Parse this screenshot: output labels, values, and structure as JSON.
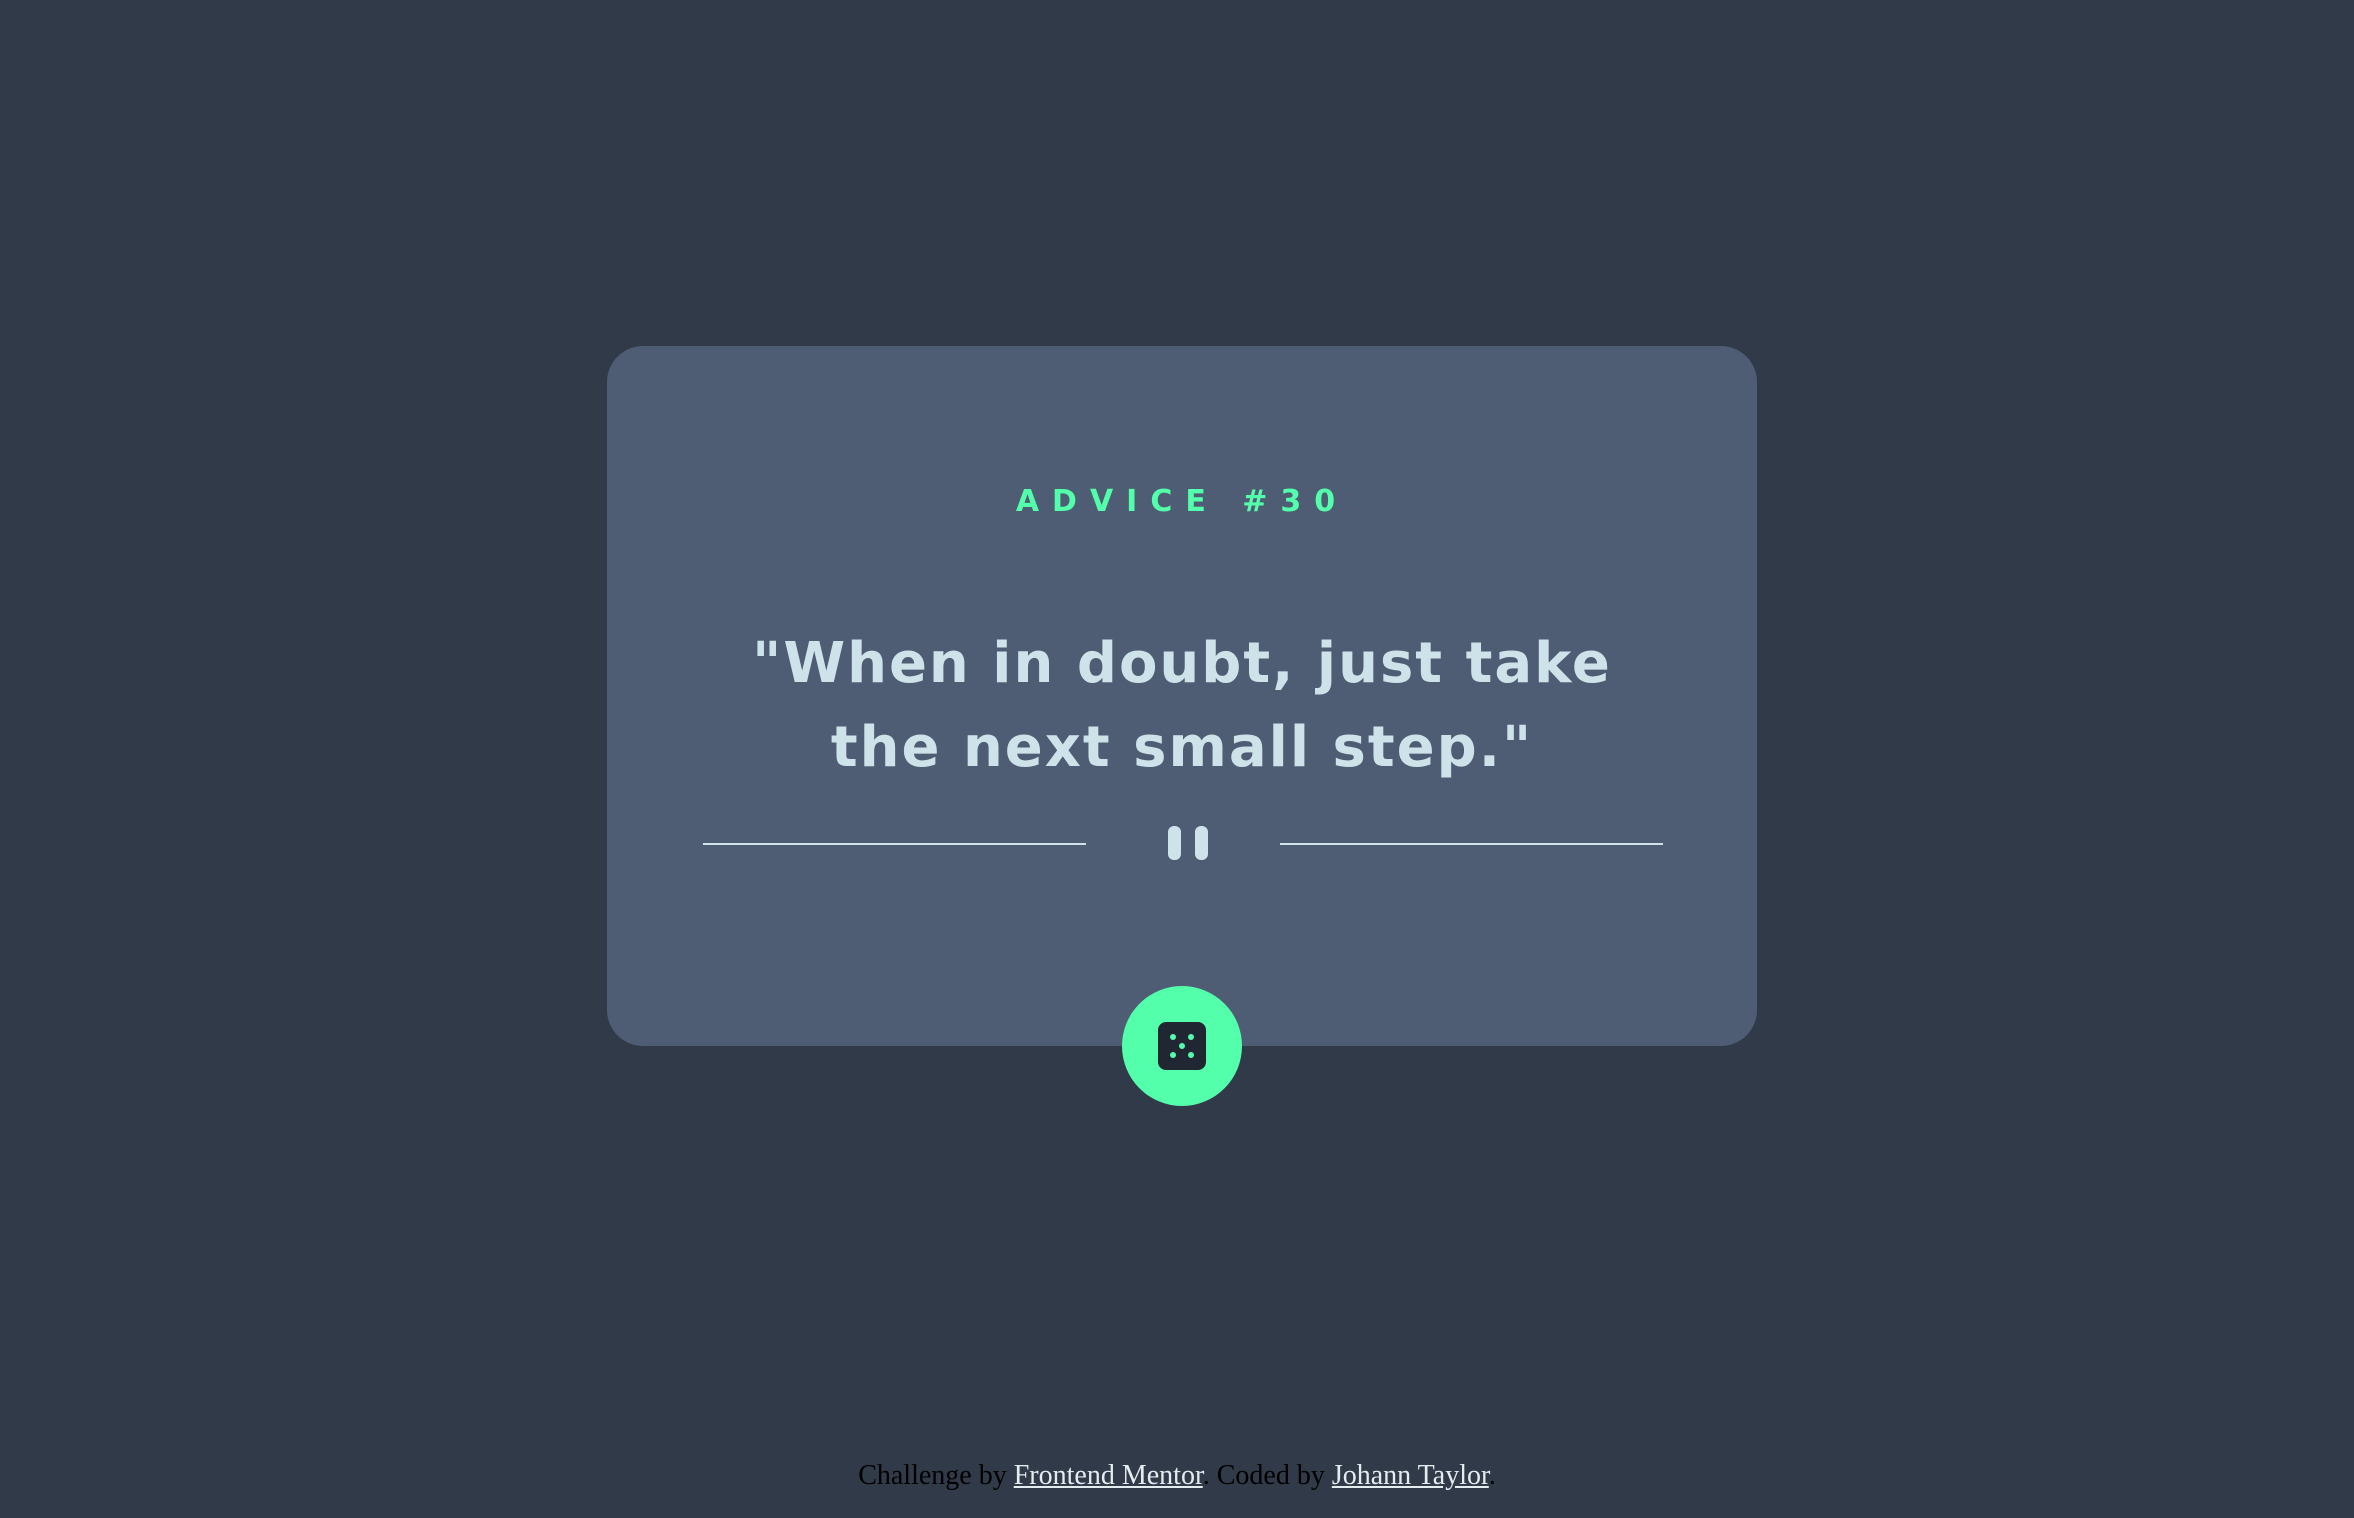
{
  "card": {
    "advice_label": "ADVICE #30",
    "quote": "\"When in doubt, just take the next small step.\""
  },
  "icons": {
    "divider_icon": "pause-quote-icon",
    "dice_icon": "dice-icon"
  },
  "footer": {
    "prefix": "Challenge by ",
    "challenge_link": "Frontend Mentor",
    "middle": ". Coded by ",
    "author_link": "Johann Taylor",
    "suffix": "."
  },
  "colors": {
    "background": "#313a49",
    "card": "#4e5d73",
    "accent": "#53ffaa",
    "text": "#cee3e9",
    "dice_body": "#202733"
  }
}
